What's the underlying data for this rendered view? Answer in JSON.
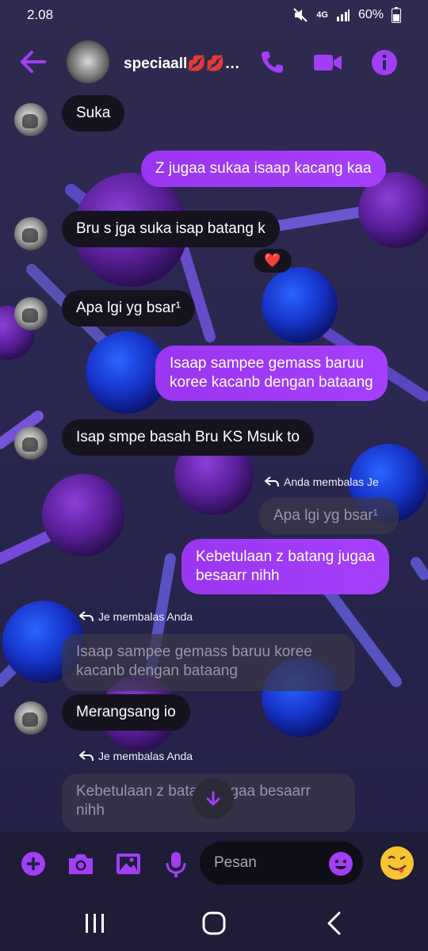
{
  "status": {
    "time": "2.08",
    "network": "4G",
    "battery": "60%",
    "icons": [
      "mute-icon",
      "network-4g-icon",
      "signal-icon",
      "battery-icon"
    ]
  },
  "header": {
    "contact_name": "speciaall💋💋…",
    "icons": [
      "back-arrow-icon",
      "phone-icon",
      "video-icon",
      "info-icon"
    ]
  },
  "messages": [
    {
      "side": "in",
      "text": "Suka"
    },
    {
      "side": "out",
      "text": "Z jugaa sukaa isaap kacang kaa"
    },
    {
      "side": "in",
      "text": "Bru s jga suka isap batang k",
      "reaction": "❤️"
    },
    {
      "side": "in",
      "text": "Apa lgi yg bsar¹"
    },
    {
      "side": "out",
      "text_line1": "Isaap sampee gemass baruu",
      "text_line2": "koree kacanb dengan bataang"
    },
    {
      "side": "in",
      "text": "Isap smpe basah Bru KS Msuk to"
    },
    {
      "side": "out",
      "reply_label": "Anda membalas Je",
      "quoted": "Apa lgi yg bsar¹",
      "text_line1": "Kebetulaan z batang jugaa",
      "text_line2": "besaarr nihh"
    },
    {
      "side": "in",
      "reply_label": "Je membalas Anda",
      "quoted_line1": "Isaap sampee gemass baruu koree",
      "quoted_line2": "kacanb dengan bataang",
      "text": "Merangsang io"
    },
    {
      "side": "in",
      "reply_label": "Je membalas Anda",
      "quoted_line1": "Kebetulaan z batang jugaa besaarr",
      "quoted_line2": "nihh"
    }
  ],
  "composer": {
    "placeholder": "Pesan",
    "icons": [
      "plus-icon",
      "camera-icon",
      "gallery-icon",
      "microphone-icon",
      "emoji-icon",
      "emoji-send-icon"
    ]
  },
  "colors": {
    "accent": "#a13ef6",
    "incoming_bubble": "#16131f",
    "quoted_bubble": "#3a3748",
    "background": "#2a2750"
  }
}
